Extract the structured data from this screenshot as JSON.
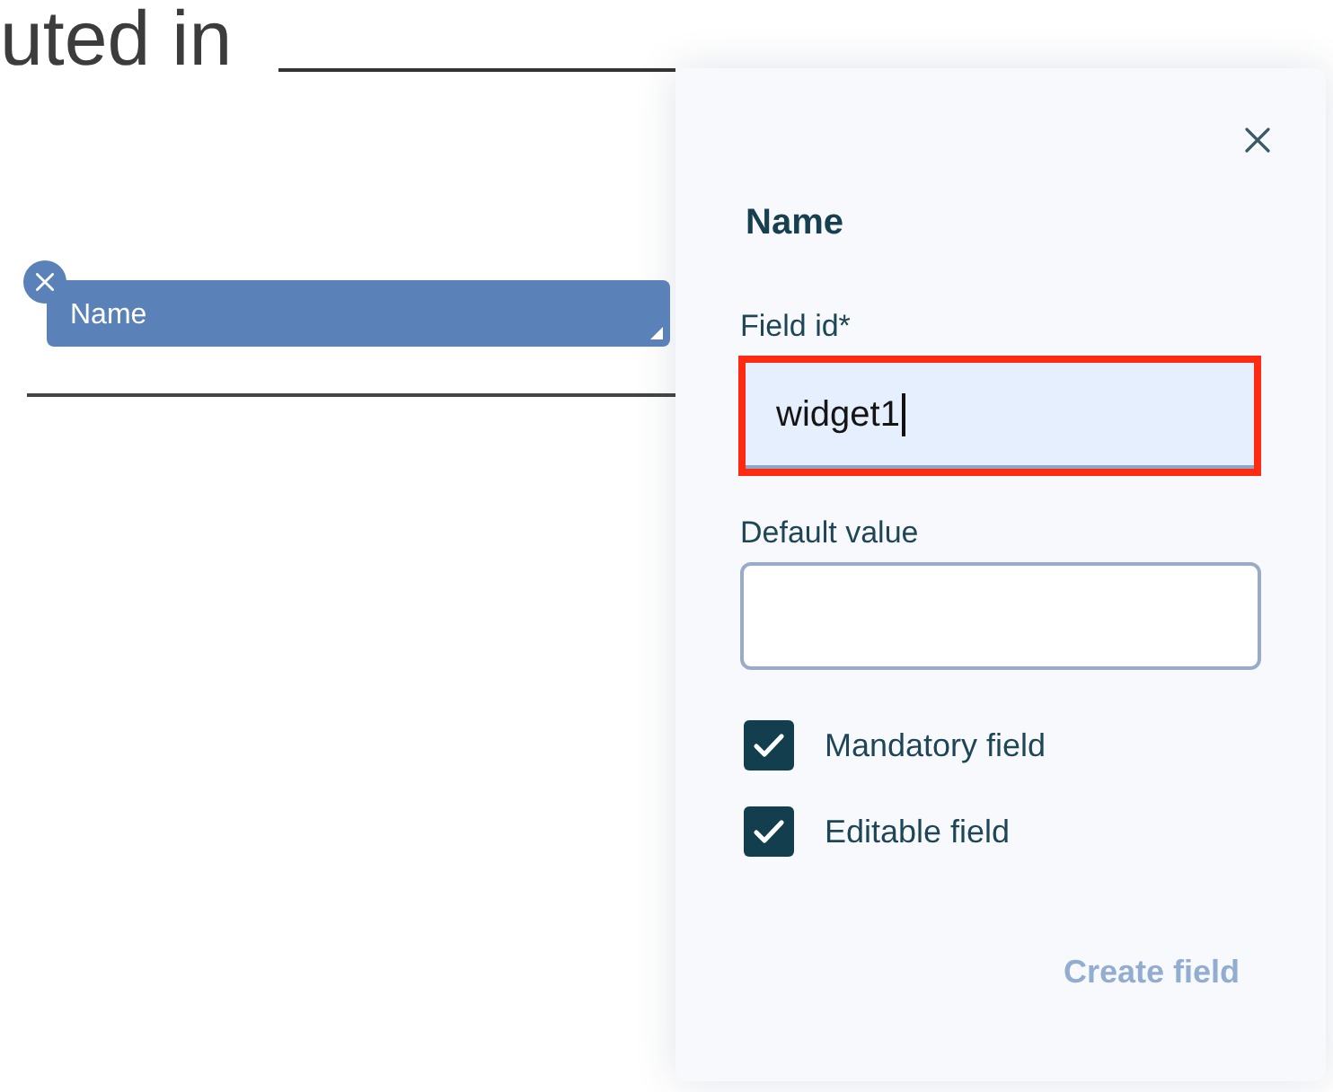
{
  "document": {
    "text": "uted in",
    "chip": {
      "label": "Name"
    }
  },
  "panel": {
    "title": "Name",
    "fields": [
      {
        "label": "Field id*",
        "value": "widget1",
        "focused": true,
        "highlighted": true
      },
      {
        "label": "Default value",
        "focused": false,
        "highlighted": false
      }
    ],
    "checkboxes": [
      {
        "label": "Mandatory field",
        "checked": true
      },
      {
        "label": "Editable field",
        "checked": true
      }
    ],
    "button": {
      "label": "Create field",
      "disabled": true
    }
  }
}
